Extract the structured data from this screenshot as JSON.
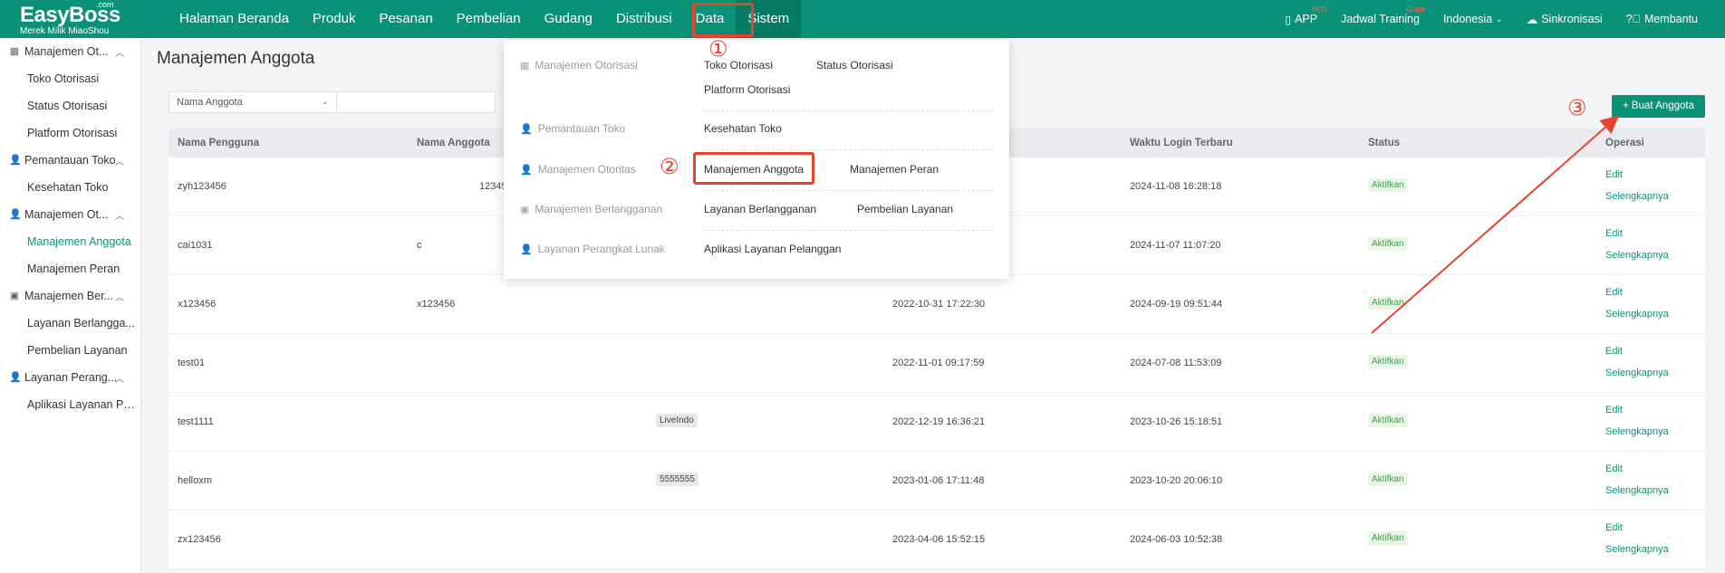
{
  "logo": {
    "brand": "EasyBoss",
    "com": ".com",
    "subtitle": "Merek Milik MiaoShou"
  },
  "nav": [
    "Halaman Beranda",
    "Produk",
    "Pesanan",
    "Pembelian",
    "Gudang",
    "Distribusi",
    "Data",
    "Sistem"
  ],
  "right_nav": {
    "app": "APP",
    "app_badge": "HOT",
    "training": "Jadwal Training",
    "training_badge": "Gratis",
    "language": "Indonesia",
    "sync": "Sinkronisasi",
    "help": "Membantu"
  },
  "sidebar": {
    "g1": "Manajemen Ot...",
    "g1_items": [
      "Toko Otorisasi",
      "Status Otorisasi",
      "Platform Otorisasi"
    ],
    "g2": "Pemantauan Toko",
    "g2_items": [
      "Kesehatan Toko"
    ],
    "g3": "Manajemen Ot...",
    "g3_items": [
      "Manajemen Anggota",
      "Manajemen Peran"
    ],
    "g4": "Manajemen Ber...",
    "g4_items": [
      "Layanan Berlangga...",
      "Pembelian Layanan"
    ],
    "g5": "Layanan Perang...",
    "g5_items": [
      "Aplikasi Layanan Pe..."
    ]
  },
  "page_title": "Manajemen Anggota",
  "filter": {
    "select": "Nama Anggota",
    "input_value": ""
  },
  "create_button": "+ Buat Anggota",
  "table": {
    "headers": [
      "Nama Pengguna",
      "Nama Anggota",
      "Waktu Login Terbaru",
      "Status",
      "Operasi"
    ],
    "rows": [
      {
        "user": "zyh123456",
        "member": "12345",
        "store": "",
        "created": "",
        "login": "2024-11-08 16:28:18",
        "status": "Aktifkan"
      },
      {
        "user": "cai1031",
        "member": "c",
        "store": "",
        "created": "",
        "login": "2024-11-07 11:07:20",
        "status": "Aktifkan"
      },
      {
        "user": "x123456",
        "member": "x123456",
        "store": "",
        "created": "2022-10-31 17:22:30",
        "login": "2024-09-19 09:51:44",
        "status": "Aktifkan"
      },
      {
        "user": "test01",
        "member": "",
        "store": "",
        "created": "2022-11-01 09:17:59",
        "login": "2024-07-08 11:53:09",
        "status": "Aktifkan"
      },
      {
        "user": "test1111",
        "member": "",
        "store": "LiveIndo",
        "created": "2022-12-19 16:36:21",
        "login": "2023-10-26 15:18:51",
        "status": "Aktifkan"
      },
      {
        "user": "helloxm",
        "member": "",
        "store": "5555555",
        "created": "2023-01-06 17:11:48",
        "login": "2023-10-20 20:06:10",
        "status": "Aktifkan"
      },
      {
        "user": "zx123456",
        "member": "",
        "store": "",
        "created": "2023-04-06 15:52:15",
        "login": "2024-06-03 10:52:38",
        "status": "Aktifkan"
      }
    ],
    "edit_label": "Edit",
    "more_label": "Selengkapnya"
  },
  "dropdown": {
    "cat1": "Manajemen Otorisasi",
    "cat1_links": [
      "Toko Otorisasi",
      "Status Otorisasi",
      "Platform Otorisasi"
    ],
    "cat2": "Pemantauan Toko",
    "cat2_links": [
      "Kesehatan Toko"
    ],
    "cat3": "Manajemen Otoritas",
    "cat3_links": [
      "Manajemen Anggota",
      "Manajemen Peran"
    ],
    "cat4": "Manajemen Berlangganan",
    "cat4_links": [
      "Layanan Berlangganan",
      "Pembelian Layanan"
    ],
    "cat5": "Layanan Perangkat Lunak",
    "cat5_links": [
      "Aplikasi Layanan Pelanggan"
    ]
  },
  "annotations": [
    "①",
    "②",
    "③"
  ],
  "colors": {
    "brand": "#0a9278",
    "annotation": "#e8432d",
    "status_green": "#3ca34b"
  },
  "icons": [
    "phone-icon",
    "cloud-icon",
    "help-icon",
    "chevron-down-icon",
    "chevron-up-icon",
    "grid-icon",
    "user-icon",
    "bookmark-icon"
  ]
}
